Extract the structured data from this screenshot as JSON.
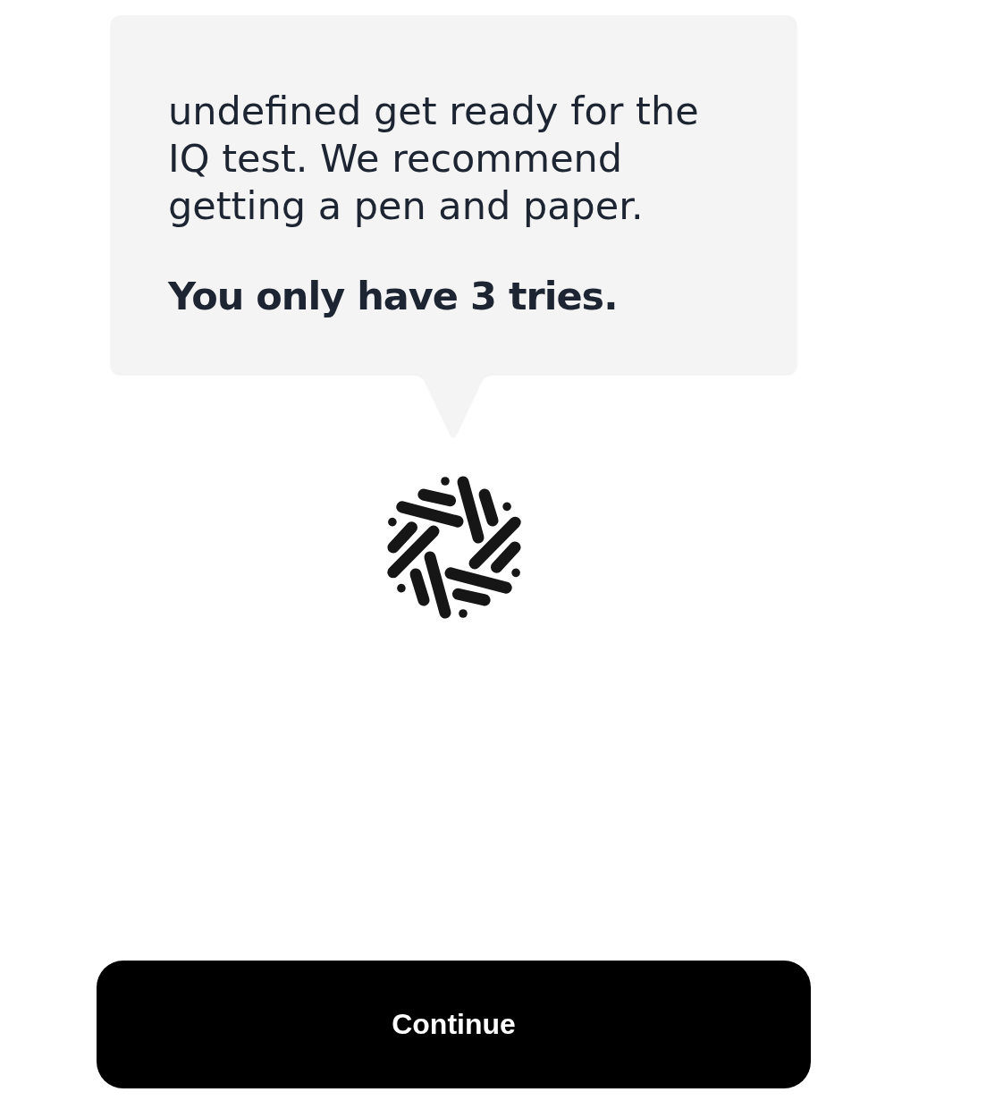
{
  "speech_bubble": {
    "paragraphs": [
      {
        "kind": "text",
        "text": "undefined get ready for the IQ test. We recommend getting a pen and paper."
      },
      {
        "kind": "emphasis",
        "text": "You only have 3 tries."
      }
    ]
  },
  "continue_button": {
    "label": "Continue"
  }
}
